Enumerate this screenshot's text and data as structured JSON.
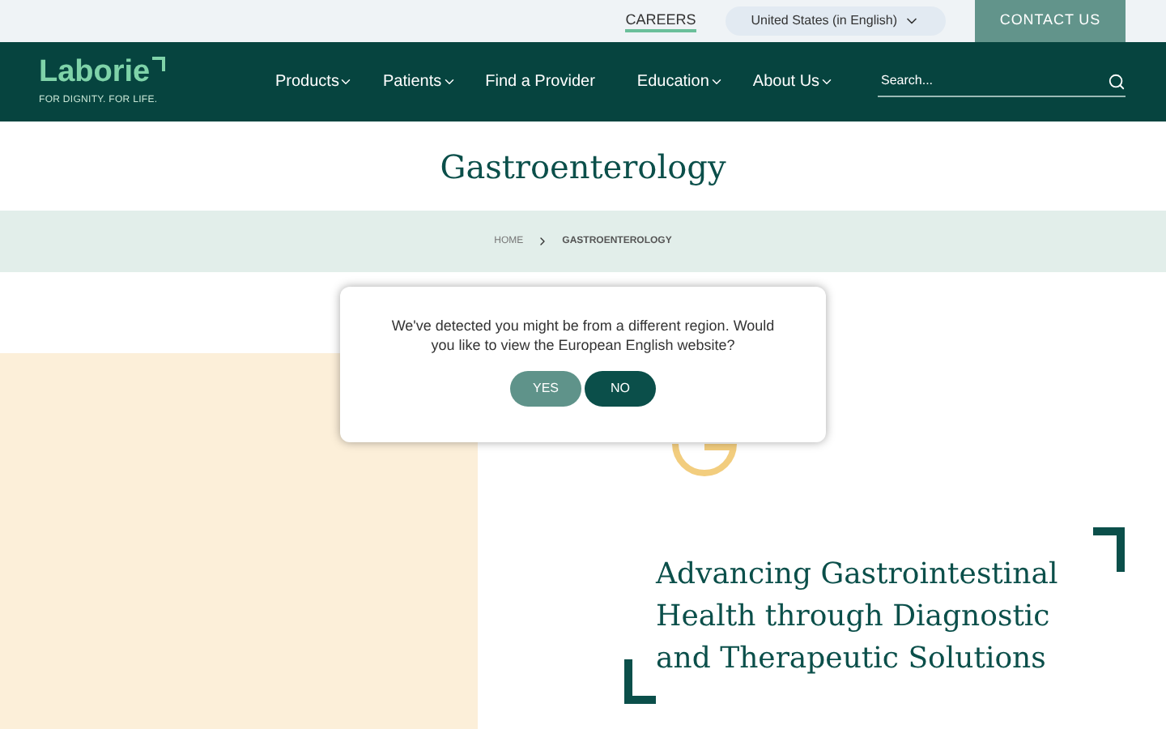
{
  "top_bar": {
    "careers": "CAREERS",
    "region": "United States (in English)",
    "contact": "CONTACT US"
  },
  "header": {
    "logo": "Laborie",
    "tagline": "FOR DIGNITY. FOR LIFE.",
    "nav": [
      {
        "label": "Products",
        "dropdown": true
      },
      {
        "label": "Patients",
        "dropdown": true
      },
      {
        "label": "Find a Provider",
        "dropdown": false
      },
      {
        "label": "Education",
        "dropdown": true
      },
      {
        "label": "About Us",
        "dropdown": true
      }
    ],
    "search": {
      "placeholder": "Search..."
    }
  },
  "page_title": "Gastroenterology",
  "breadcrumb": [
    "HOME",
    "GASTROENTEROLOGY"
  ],
  "hero_heading": "Advancing Gastrointestinal Health through Diagnostic and Therapeutic Solutions",
  "region_dialog": {
    "message": "We've detected you might be from a different region. Would you like to view the European English website?",
    "buttons": [
      {
        "label": "YES",
        "kind": "secondary"
      },
      {
        "label": "NO",
        "kind": "primary"
      }
    ]
  }
}
